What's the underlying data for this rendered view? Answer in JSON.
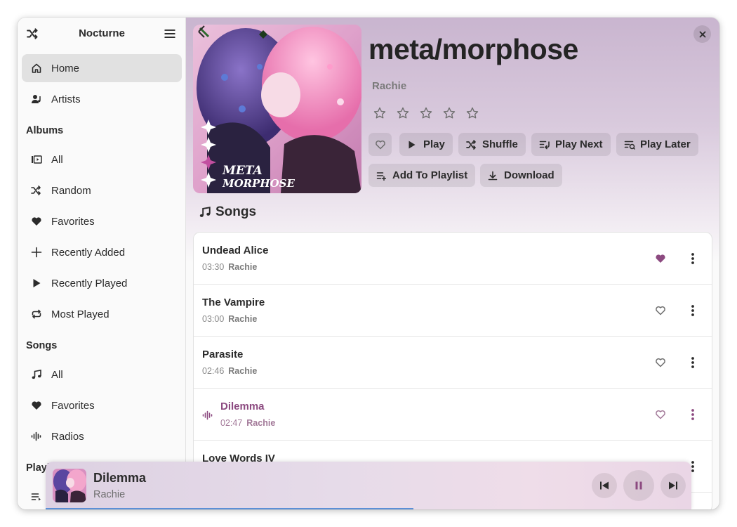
{
  "app": {
    "title": "Nocturne"
  },
  "sidebar": {
    "items": [
      {
        "label": "Home",
        "icon": "home-icon",
        "active": true
      },
      {
        "label": "Artists",
        "icon": "artist-icon"
      }
    ],
    "albums_section": "Albums",
    "albums": [
      {
        "label": "All",
        "icon": "album-library-icon"
      },
      {
        "label": "Random",
        "icon": "shuffle-icon"
      },
      {
        "label": "Favorites",
        "icon": "heart-icon"
      },
      {
        "label": "Recently Added",
        "icon": "plus-icon"
      },
      {
        "label": "Recently Played",
        "icon": "play-icon"
      },
      {
        "label": "Most Played",
        "icon": "repeat-icon"
      }
    ],
    "songs_section": "Songs",
    "songs": [
      {
        "label": "All",
        "icon": "music-note-icon"
      },
      {
        "label": "Favorites",
        "icon": "heart-icon"
      },
      {
        "label": "Radios",
        "icon": "radio-wave-icon"
      }
    ],
    "playlists_section": "Playl"
  },
  "album": {
    "title": "meta/morphose",
    "artist": "Rachie",
    "rating": 0,
    "cover_text_line1": "META",
    "cover_text_line2": "MORPHOSE",
    "actions": {
      "play": "Play",
      "shuffle": "Shuffle",
      "play_next": "Play Next",
      "play_later": "Play Later",
      "add_to_playlist": "Add To Playlist",
      "download": "Download"
    }
  },
  "songs_header": "Songs",
  "songs": [
    {
      "title": "Undead Alice",
      "duration": "03:30",
      "artist": "Rachie",
      "favorite": true,
      "playing": false
    },
    {
      "title": "The Vampire",
      "duration": "03:00",
      "artist": "Rachie",
      "favorite": false,
      "playing": false
    },
    {
      "title": "Parasite",
      "duration": "02:46",
      "artist": "Rachie",
      "favorite": false,
      "playing": false
    },
    {
      "title": "Dilemma",
      "duration": "02:47",
      "artist": "Rachie",
      "favorite": false,
      "playing": true
    },
    {
      "title": "Love Words IV",
      "duration": "",
      "artist": "",
      "favorite": false,
      "playing": false
    }
  ],
  "player": {
    "title": "Dilemma",
    "artist": "Rachie",
    "progress": 0.57
  },
  "colors": {
    "accent": "#8c4a80",
    "progress": "#5c8fd6"
  }
}
